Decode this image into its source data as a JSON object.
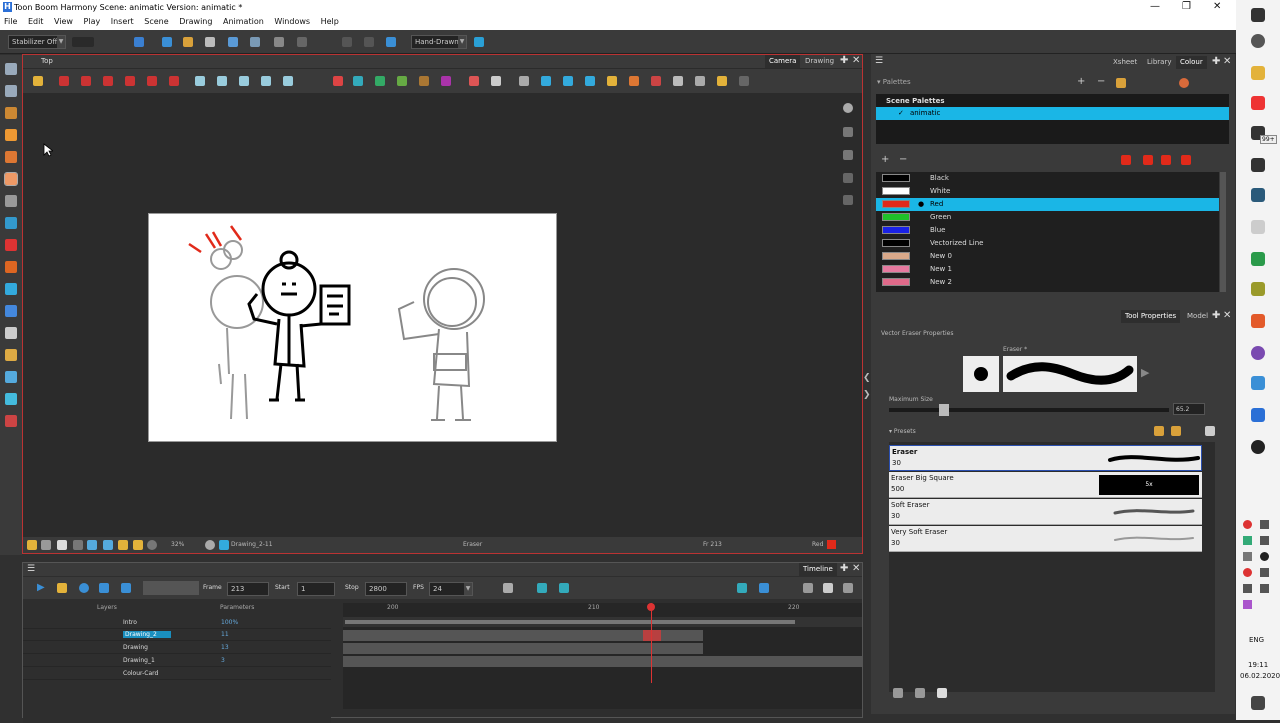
{
  "app": {
    "title": "Toon Boom Harmony Scene: animatic Version: animatic *",
    "logo": "H"
  },
  "menu": [
    "File",
    "Edit",
    "View",
    "Play",
    "Insert",
    "Scene",
    "Drawing",
    "Animation",
    "Windows",
    "Help"
  ],
  "toolbar": {
    "stabilizer": "Stabilizer Off",
    "mode": "Hand-Drawn"
  },
  "view": {
    "tab_top": "Top",
    "tabs": [
      "Camera",
      "Drawing"
    ],
    "status": {
      "zoom": "32%",
      "drawing": "Drawing_2-11",
      "tool": "Eraser",
      "frame": "Fr 213",
      "color": "Red",
      "color_hex": "#e12a1a"
    }
  },
  "right": {
    "tabs": [
      "Xsheet",
      "Library",
      "Colour"
    ],
    "palettes_label": "Palettes",
    "scene_palettes": "Scene Palettes",
    "palette_item": "animatic",
    "colors": [
      {
        "name": "Black",
        "hex": "#000000"
      },
      {
        "name": "White",
        "hex": "#ffffff"
      },
      {
        "name": "Red",
        "hex": "#e12a1a"
      },
      {
        "name": "Green",
        "hex": "#1fc02a"
      },
      {
        "name": "Blue",
        "hex": "#1a22e6"
      },
      {
        "name": "Vectorized Line",
        "hex": "#000000"
      },
      {
        "name": "New 0",
        "hex": "#d9a98a"
      },
      {
        "name": "New 1",
        "hex": "#e67aa0"
      },
      {
        "name": "New 2",
        "hex": "#e06a8a"
      }
    ],
    "selected_color": "Red"
  },
  "toolprops": {
    "tabs": [
      "Tool Properties",
      "Model"
    ],
    "title": "Vector Eraser Properties",
    "eraser_label": "Eraser *",
    "max_size_label": "Maximum Size",
    "max_size": "65.2",
    "max_size_fraction": 0.18,
    "presets_label": "Presets",
    "presets": [
      {
        "name": "Eraser",
        "value": "30"
      },
      {
        "name": "Eraser Big Square",
        "value": "500"
      },
      {
        "name": "Soft Eraser",
        "value": "30"
      },
      {
        "name": "Very Soft Eraser",
        "value": "30"
      }
    ],
    "big_square_badge": "5x"
  },
  "timeline": {
    "tab": "Timeline",
    "frame_label": "Frame",
    "frame": "213",
    "start_label": "Start",
    "start": "1",
    "stop_label": "Stop",
    "stop": "2800",
    "fps_label": "FPS",
    "fps": "24",
    "layers_label": "Layers",
    "params_label": "Parameters",
    "ruler": [
      "200",
      "210",
      "220"
    ],
    "layers": [
      {
        "name": "Intro",
        "param": "100%"
      },
      {
        "name": "Drawing_2",
        "param": "11"
      },
      {
        "name": "Drawing",
        "param": "13"
      },
      {
        "name": "Drawing_1",
        "param": "3"
      },
      {
        "name": "Colour-Card",
        "param": ""
      }
    ]
  },
  "taskbar": {
    "badge": "99+",
    "lang": "ENG",
    "time": "19:11",
    "date": "06.02.2020"
  }
}
